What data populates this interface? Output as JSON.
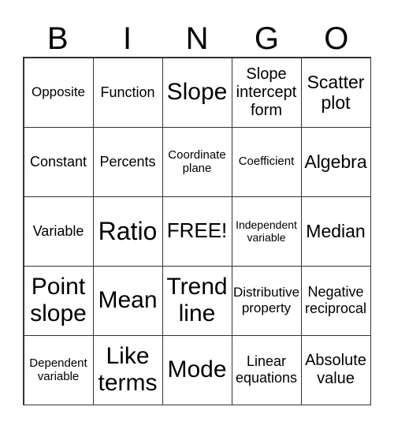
{
  "header": [
    "B",
    "I",
    "N",
    "G",
    "O"
  ],
  "cells": [
    "Opposite",
    "Function",
    "Slope",
    "Slope intercept form",
    "Scatter plot",
    "Constant",
    "Percents",
    "Coordinate plane",
    "Coefficient",
    "Algebra",
    "Variable",
    "Ratio",
    "FREE!",
    "Independent variable",
    "Median",
    "Point slope",
    "Mean",
    "Trend line",
    "Distributive property",
    "Negative reciprocal",
    "Dependent variable",
    "Like terms",
    "Mode",
    "Linear equations",
    "Absolute value"
  ]
}
